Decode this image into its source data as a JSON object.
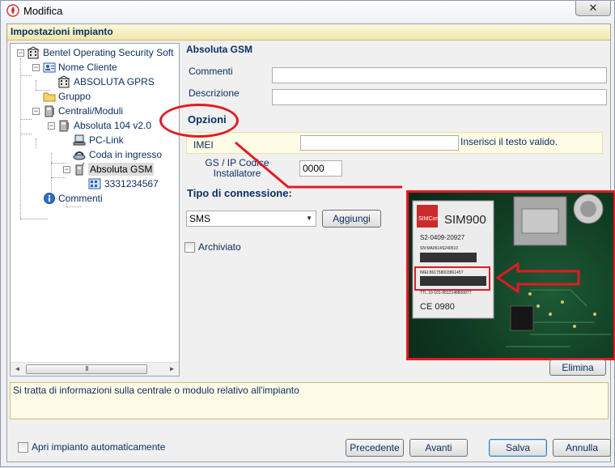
{
  "window": {
    "title": "Modifica",
    "close_glyph": "✕",
    "icon": "app-flame-icon"
  },
  "header": {
    "title": "Impostazioni impianto"
  },
  "tree": {
    "root": "Bentel Operating Security Soft",
    "nome_cliente": "Nome Cliente",
    "cliente_item": "ABSOLUTA GPRS",
    "gruppo": "Gruppo",
    "centrali": "Centrali/Moduli",
    "centrale": "Absoluta 104 v2.0",
    "pc_link": "PC-Link",
    "coda": "Coda in ingresso",
    "gsm": "Absoluta GSM",
    "phone": "3331234567",
    "commenti": "Commenti",
    "scroll_thumb_grip": "III",
    "scroll_left": "◄",
    "scroll_right": "►"
  },
  "form": {
    "title": "Absoluta GSM",
    "commenti_label": "Commenti",
    "descrizione_label": "Descrizione",
    "opzioni_title": "Opzioni",
    "imei_label": "IMEI",
    "imei_value": "",
    "imei_message": "Inserisci il testo valido.",
    "code_label": "GS / IP Codice Installatore",
    "code_value": "0000",
    "conn_title": "Tipo di connessione:",
    "conn_selected": "SMS",
    "aggiungi": "Aggiungi",
    "archiviato": "Archiviato",
    "elimina": "Elimina"
  },
  "photo": {
    "module_name": "SIM900",
    "module_line1": "S2-0409-20927",
    "module_line2": "SN:MA0614S240510",
    "imei_text": "IMEI:86175800386145?",
    "bottom_line": "TTL 10-101-9512148800077",
    "ce_mark": "CE 0980",
    "brand": "SIMCom",
    "highlight_color": "#e01b24"
  },
  "info": {
    "text": "Si tratta di informazioni sulla centrale o modulo relativo all'impianto"
  },
  "footer": {
    "auto_open": "Apri impianto automaticamente",
    "precedente": "Precedente",
    "avanti": "Avanti",
    "salva": "Salva",
    "annulla": "Annulla"
  }
}
